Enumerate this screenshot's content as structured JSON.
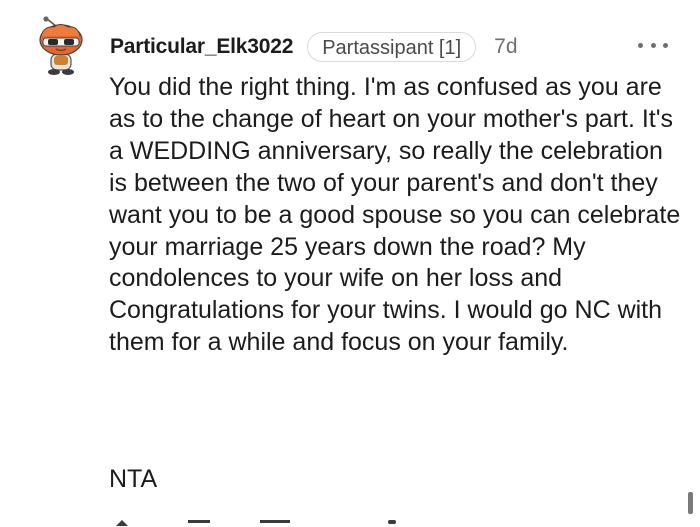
{
  "comment": {
    "username": "Particular_Elk3022",
    "flair": "Partassipant [1]",
    "time": "7d",
    "body": "You did the right thing. I'm as confused as you are as to the change of heart on your mother's part. It's a WEDDING anniversary, so really the celebration is between the two of your parent's and don't they want you to be a good spouse so you can celebrate your marriage 25 years down the road? My condolences to your wife on her loss and Congratulations for your twins. I would go NC with them for a while and focus on your family.",
    "verdict": "NTA"
  },
  "icons": {
    "avatar": "snoo-avatar-icon",
    "more": "more-options-icon"
  },
  "colors": {
    "text": "#1c1c1c",
    "meta": "#6f6f6f",
    "flair_border": "#dadada",
    "avatar_orange": "#e8652d"
  }
}
